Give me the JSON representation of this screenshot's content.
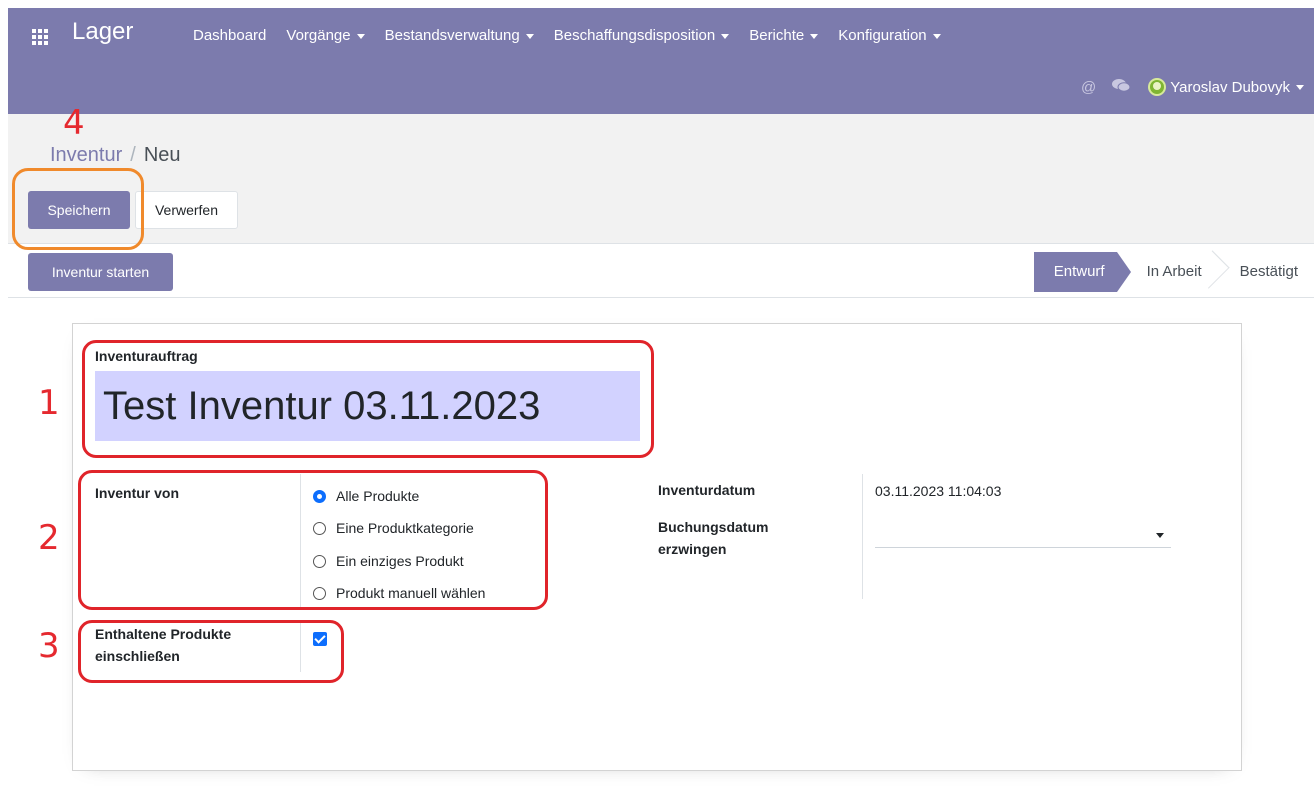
{
  "navbar": {
    "brand": "Lager",
    "menu": [
      {
        "label": "Dashboard",
        "dropdown": false
      },
      {
        "label": "Vorgänge",
        "dropdown": true
      },
      {
        "label": "Bestandsverwaltung",
        "dropdown": true
      },
      {
        "label": "Beschaffungsdisposition",
        "dropdown": true
      },
      {
        "label": "Berichte",
        "dropdown": true
      },
      {
        "label": "Konfiguration",
        "dropdown": true
      }
    ],
    "user_name": "Yaroslav Dubovyk",
    "color": "#7c7bad"
  },
  "breadcrumb": {
    "parent": "Inventur",
    "separator": "/",
    "current": "Neu"
  },
  "actions": {
    "save_label": "Speichern",
    "discard_label": "Verwerfen"
  },
  "statusbar": {
    "start_label": "Inventur starten",
    "steps": [
      {
        "label": "Entwurf",
        "active": true
      },
      {
        "label": "In Arbeit",
        "active": false
      },
      {
        "label": "Bestätigt",
        "active": false
      }
    ]
  },
  "form": {
    "title_label": "Inventurauftrag",
    "title_value": "Test Inventur 03.11.2023",
    "inventory_of_label": "Inventur von",
    "inventory_of_options": [
      {
        "label": "Alle Produkte",
        "checked": true
      },
      {
        "label": "Eine Produktkategorie",
        "checked": false
      },
      {
        "label": "Ein einziges Produkt",
        "checked": false
      },
      {
        "label": "Produkt manuell wählen",
        "checked": false
      }
    ],
    "include_label_line1": "Enthaltene Produkte",
    "include_label_line2": "einschließen",
    "include_checked": true,
    "date_label": "Inventurdatum",
    "date_value": "03.11.2023 11:04:03",
    "accounting_date_label_line1": "Buchungsdatum",
    "accounting_date_label_line2": "erzwingen",
    "accounting_date_value": ""
  },
  "annotations": {
    "n1": "1",
    "n2": "2",
    "n3": "3",
    "n4": "4",
    "red": "#e5292f",
    "orange": "#f08a2c"
  }
}
